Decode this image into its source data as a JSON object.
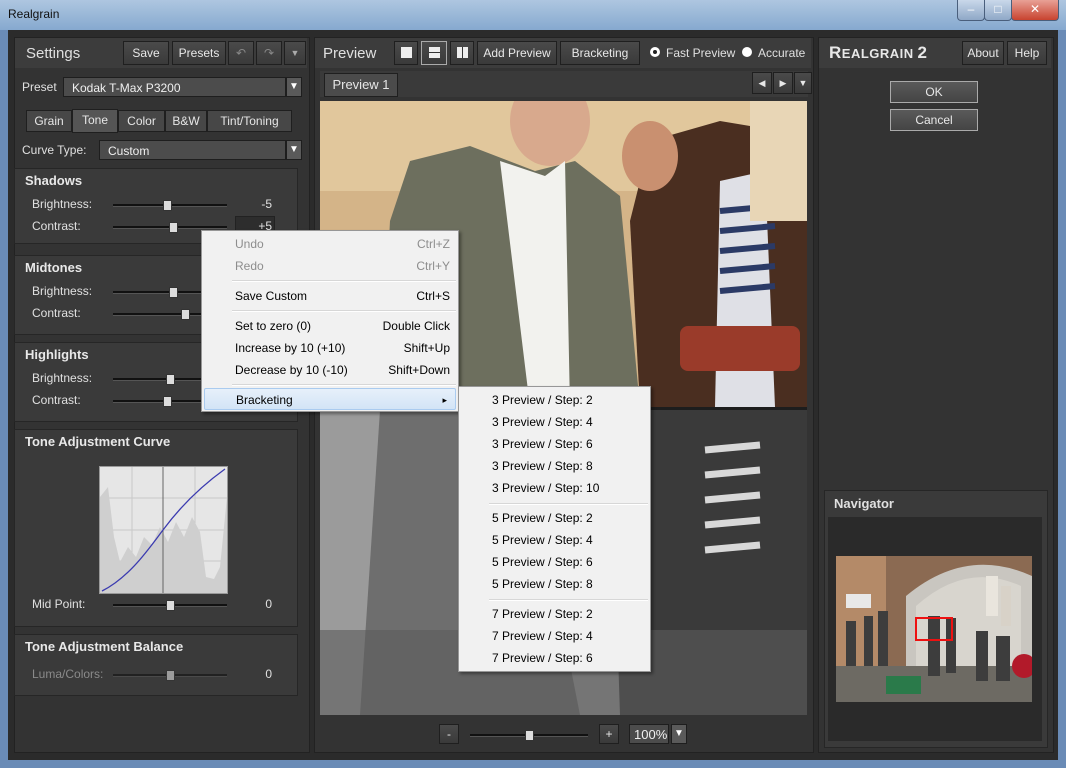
{
  "window": {
    "title": "Realgrain"
  },
  "settings": {
    "title": "Settings",
    "save_label": "Save",
    "presets_label": "Presets",
    "preset_label": "Preset",
    "preset_value": "Kodak T-Max P3200",
    "tabs": [
      "Grain",
      "Tone",
      "Color",
      "B&W",
      "Tint/Toning"
    ],
    "active_tab": "Tone",
    "curve_type_label": "Curve Type:",
    "curve_type_value": "Custom",
    "brightness_label": "Brightness:",
    "contrast_label": "Contrast:",
    "shadows": {
      "title": "Shadows",
      "brightness": "-5",
      "contrast": "+5",
      "brightness_level": 0.47,
      "contrast_level": 0.53
    },
    "midtones": {
      "title": "Midtones",
      "brightness_level": 0.53,
      "contrast_level": 0.63
    },
    "highlights": {
      "title": "Highlights",
      "brightness_level": 0.5,
      "contrast_level": 0.47
    },
    "curve": {
      "title": "Tone Adjustment Curve",
      "midpoint_label": "Mid Point:",
      "midpoint_value": "0",
      "midpoint_level": 0.5
    },
    "balance": {
      "title": "Tone Adjustment Balance",
      "luma_label": "Luma/Colors:",
      "luma_value": "0",
      "luma_level": 0.5
    }
  },
  "preview": {
    "title": "Preview",
    "add_preview": "Add Preview",
    "bracketing": "Bracketing",
    "fast_preview": "Fast Preview",
    "accurate": "Accurate",
    "tab_label": "Preview 1",
    "zoom_minus": "-",
    "zoom_plus": "+",
    "zoom_value": "100%",
    "zoom_level": 0.5
  },
  "right": {
    "brand_a": "R",
    "brand_b": "EALGRAIN",
    "brand_num": "2",
    "about": "About",
    "help": "Help",
    "ok": "OK",
    "cancel": "Cancel",
    "navigator": "Navigator"
  },
  "context_menu": {
    "items": [
      {
        "label": "Undo",
        "shortcut": "Ctrl+Z",
        "disabled": true
      },
      {
        "label": "Redo",
        "shortcut": "Ctrl+Y",
        "disabled": true
      },
      {
        "label": "Save Custom",
        "shortcut": "Ctrl+S"
      },
      {
        "label": "Set to zero (0)",
        "shortcut": "Double Click"
      },
      {
        "label": "Increase by 10 (+10)",
        "shortcut": "Shift+Up"
      },
      {
        "label": "Decrease by 10 (-10)",
        "shortcut": "Shift+Down"
      },
      {
        "label": "Bracketing",
        "shortcut": "▸"
      }
    ]
  },
  "bracketing_menu": {
    "items": [
      "3 Preview / Step: 2",
      "3 Preview / Step: 4",
      "3 Preview / Step: 6",
      "3 Preview / Step: 8",
      "3 Preview / Step: 10",
      "5 Preview / Step: 2",
      "5 Preview / Step: 4",
      "5 Preview / Step: 6",
      "5 Preview / Step: 8",
      "7 Preview / Step: 2",
      "7 Preview / Step: 4",
      "7 Preview / Step: 6"
    ]
  }
}
